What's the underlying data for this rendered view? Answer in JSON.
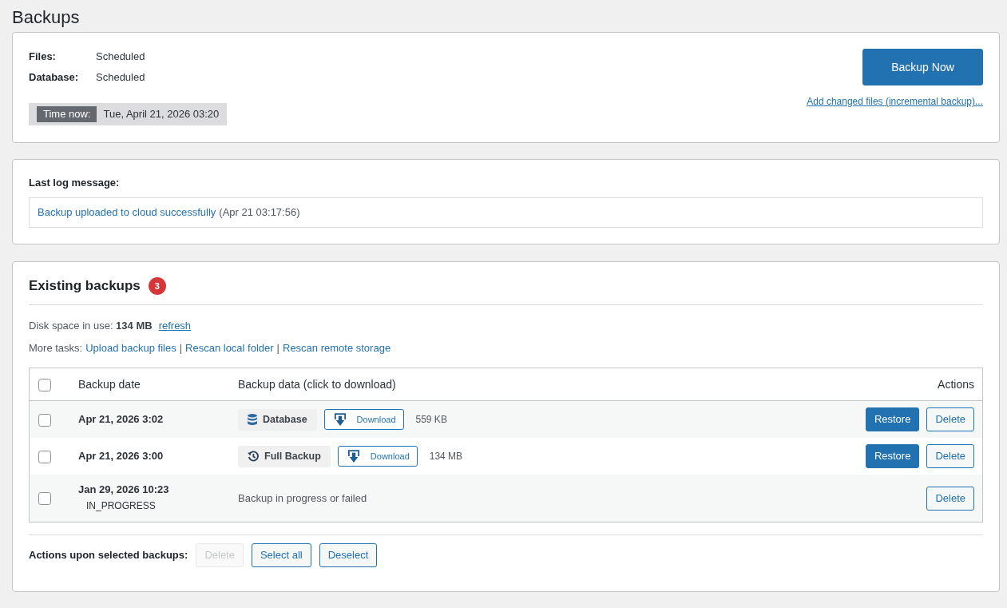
{
  "page_title": "Backups",
  "status": {
    "schedule": [
      {
        "label": "Files:",
        "value": "Scheduled"
      },
      {
        "label": "Database:",
        "value": "Scheduled"
      }
    ],
    "time_label": "Time now:",
    "time_value": "Tue, April 21, 2026 03:20",
    "backup_button": "Backup Now",
    "incremental_link": "Add changed files (incremental backup)..."
  },
  "log": {
    "label": "Last log message:",
    "message": "Backup uploaded to cloud successfully",
    "time": "(Apr 21 03:17:56)"
  },
  "backups": {
    "title": "Existing backups",
    "count": "3",
    "disk_text": "Disk space in use: **134 MB**",
    "refresh": "refresh",
    "tasks_label": "More tasks:",
    "tasks": [
      "Upload backup files",
      "Rescan local folder",
      "Rescan remote storage"
    ],
    "task_separator": "|",
    "table": {
      "select_all_checked": false,
      "columns": [
        "Backup date",
        "Backup data (click to download)",
        "Actions"
      ],
      "rows": [
        {
          "kind": "complete",
          "checked": false,
          "date": "Apr 21, 2026 3:02",
          "entities": [
            {
              "kind": "database",
              "label": "Database",
              "download": "Download"
            }
          ],
          "size": "559 KB",
          "restore": "Restore",
          "delete": "Delete"
        },
        {
          "kind": "complete",
          "checked": false,
          "date": "Apr 21, 2026 3:00",
          "entities": [
            {
              "kind": "full",
              "label": "Full Backup",
              "download": "Download"
            }
          ],
          "size": "134 MB",
          "restore": "Restore",
          "delete": "Delete"
        },
        {
          "kind": "in_progress",
          "checked": false,
          "date": "Jan 29, 2026 10:23",
          "status": "IN_PROGRESS",
          "note": "Backup in progress or failed",
          "delete": "Delete"
        }
      ]
    },
    "bulk": {
      "label": "Actions upon selected backups:",
      "buttons": [
        {
          "label": "Delete",
          "disabled": true
        },
        {
          "label": "Select all",
          "disabled": false
        },
        {
          "label": "Deselect",
          "disabled": false
        }
      ]
    }
  }
}
